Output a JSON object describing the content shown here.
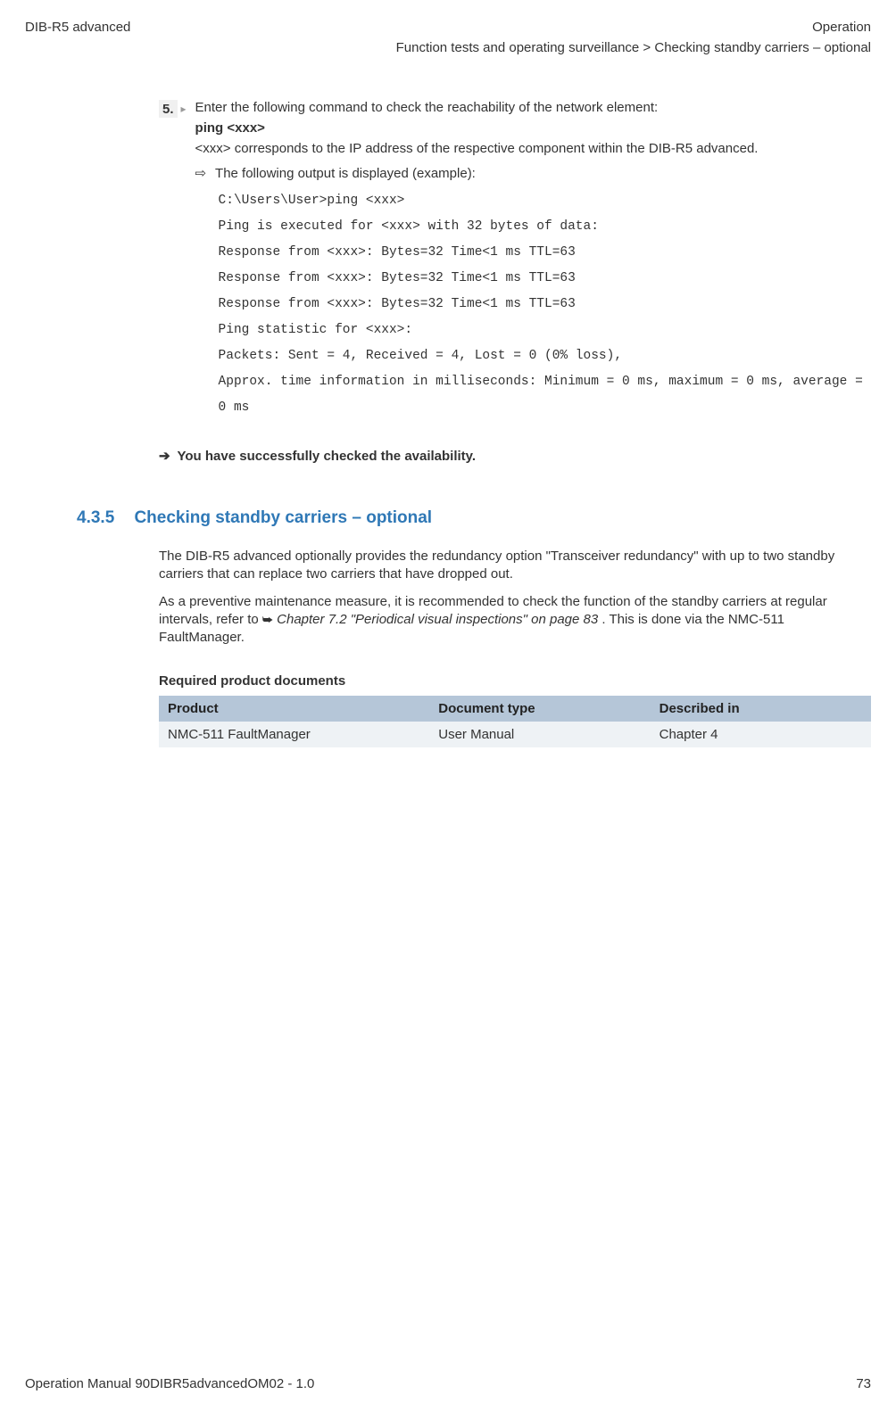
{
  "header": {
    "left": "DIB-R5 advanced",
    "right": "Operation",
    "breadcrumb": "Function tests and operating surveillance > Checking standby carriers – optional"
  },
  "step": {
    "number": "5.",
    "instruction": "Enter the following command to check the reachability of the network element:",
    "command": "ping <xxx>",
    "note": "<xxx> corresponds to the IP address of the respective component within the DIB-R5 advanced.",
    "result_label": "The following output is displayed (example):",
    "code": [
      "C:\\Users\\User>ping <xxx>",
      "Ping is executed for <xxx> with 32 bytes of data:",
      "Response from <xxx>: Bytes=32 Time<1 ms TTL=63",
      "Response from <xxx>: Bytes=32 Time<1 ms TTL=63",
      "Response from <xxx>: Bytes=32 Time<1 ms TTL=63",
      "Ping statistic for <xxx>:",
      "Packets: Sent = 4, Received = 4, Lost = 0 (0% loss),",
      "Approx. time information in milliseconds: Minimum = 0 ms, maximum = 0 ms, average = 0 ms"
    ]
  },
  "conclusion": "You have successfully checked the availability.",
  "section": {
    "number": "4.3.5",
    "title": "Checking standby carriers – optional",
    "para1": "The DIB-R5 advanced optionally provides the redundancy option \"Transceiver redundancy\" with up to two standby carriers that can replace two carriers that have dropped out.",
    "para2_a": "As a preventive maintenance measure, it is recommended to check the function of the standby carriers at regular intervals, refer to ",
    "para2_ref": "Chapter 7.2 \"Periodical visual inspections\" on page 83",
    "para2_b": ". This is done via the NMC-511 FaultManager."
  },
  "docs": {
    "heading": "Required product documents",
    "headers": {
      "c1": "Product",
      "c2": "Document type",
      "c3": "Described in"
    },
    "rows": [
      {
        "c1": "NMC-511 FaultManager",
        "c2": "User Manual",
        "c3": "Chapter 4"
      }
    ]
  },
  "footer": {
    "left": "Operation Manual 90DIBR5advancedOM02 - 1.0",
    "right": "73"
  }
}
